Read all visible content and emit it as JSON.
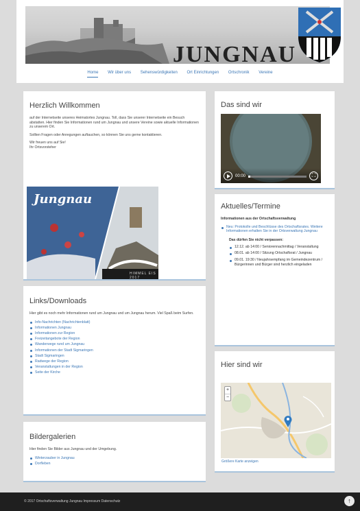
{
  "header": {
    "site_title": "JUNGNAU"
  },
  "nav": {
    "items": [
      "Home",
      "Wir über uns",
      "Sehenswürdigkeiten",
      "Ort Einrichtungen",
      "Ortschronik",
      "Vereine"
    ],
    "active": 0
  },
  "welcome": {
    "title": "Herzlich Willkommen",
    "p1": "auf der Internetseite unseres Heimatortes Jungnau. Toll, dass Sie unserer Internetseite ein Besuch abstatten. Hier finden Sie Informationen rund um Jungnau und unsere Vereine sowie aktuelle Informationen zu unserem Ort.",
    "p2": "Sollten Fragen oder Anregungen auftauchen, so können Sie uns gerne kontaktieren.",
    "sign1": "Wir freuen uns auf Sie!",
    "sign2": "Ihr Ortsvorsteher"
  },
  "photo": {
    "script_text": "Jungnau",
    "caption": "HIMMEL EIS 2017"
  },
  "links": {
    "title": "Links/Downloads",
    "intro": "Hier gibt es noch mehr Informationen rund um Jungnau und um Jungnau herum. Viel Spaß beim Surfen.",
    "items": [
      "Info-Nachrichten (Nachrichtenblatt)",
      "Informationen Jungnau",
      "Informationen zur Region",
      "Freizeitangebote der Region",
      "Wanderwege rund um Jungnau",
      "Informationen der Stadt Sigmaringen",
      "Stadt Sigmaringen",
      "Radwege der Region",
      "Veranstaltungen in der Region",
      "Seite der Kirche"
    ]
  },
  "gallery": {
    "title": "Bildergalerien",
    "intro": "Hier finden Sie Bilder aus Jungnau und der Umgebung.",
    "items": [
      "Winterzauber in Jungnau",
      "Dorfleben"
    ]
  },
  "about": {
    "title": "Das sind wir",
    "time": "00:00"
  },
  "news": {
    "title": "Aktuelles/Termine",
    "subtitle": "Informationen aus der Ortschaftsverwaltung",
    "bullet": "Neu: Protokolle und Beschlüsse des Ortschaftsrates. Weitere Informationen erhalten Sie in der Ortsverwaltung Jungnau",
    "heading2": "Das dürfen Sie nicht verpassen:",
    "events": [
      "12.12. ab 14:00 / Seniorennachmittag / Veranstaltung",
      "08.01. ab 14:00 / Sitzung Ortschaftsrat / Jungnau",
      "09.01. 19:30 / Neujahrsempfang im Gemeindezentrum / Bürgerinnen und Bürger sind herzlich eingeladen"
    ]
  },
  "location": {
    "title": "Hier sind wir",
    "map_link": "Größere Karte anzeigen",
    "zoom_in": "+",
    "zoom_out": "−"
  },
  "footer": {
    "text": "© 2017 Ortschaftsverwaltung Jungnau   Impressum   Datenschutz",
    "icon": "↑"
  }
}
